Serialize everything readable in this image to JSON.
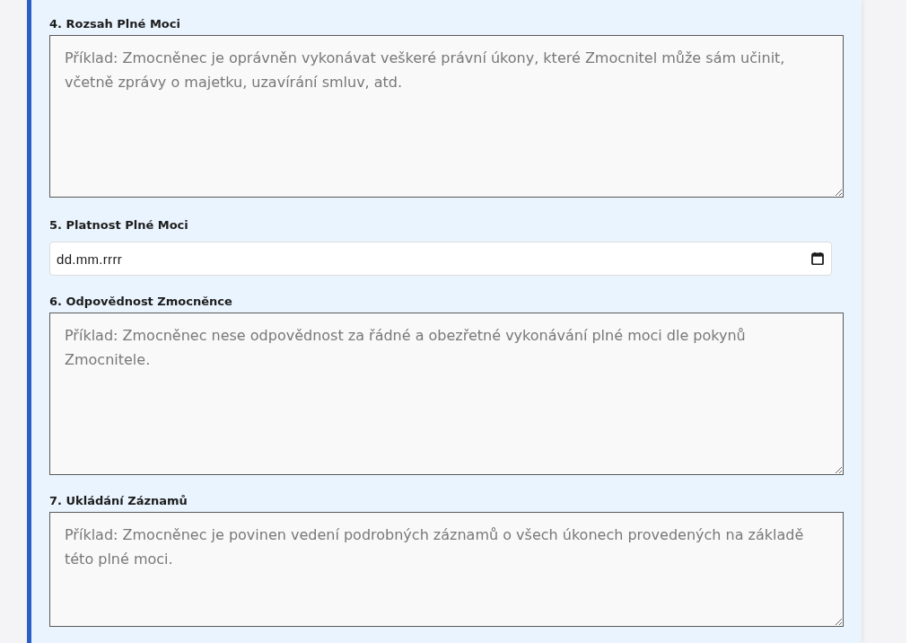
{
  "form": {
    "fields": [
      {
        "kind": "textarea",
        "label": "4. Rozsah Plné Moci",
        "placeholder": "Příklad: Zmocněnec je oprávněn vykonávat veškeré právní úkony, které Zmocnitel může sám učinit, včetně zprávy o majetku, uzavírání smluv, atd."
      },
      {
        "kind": "date",
        "label": "5. Platnost Plné Moci",
        "placeholder": "dd.mm.rrrr"
      },
      {
        "kind": "textarea",
        "label": "6. Odpovědnost Zmocněnce",
        "placeholder": "Příklad: Zmocněnec nese odpovědnost za řádné a obezřetné vykonávání plné moci dle pokynů Zmocnitele."
      },
      {
        "kind": "textarea",
        "label": "7. Ukládání Záznamů",
        "placeholder": "Příklad: Zmocněnec je povinen vedení podrobných záznamů o všech úkonech provedených na základě této plné moci."
      }
    ]
  }
}
